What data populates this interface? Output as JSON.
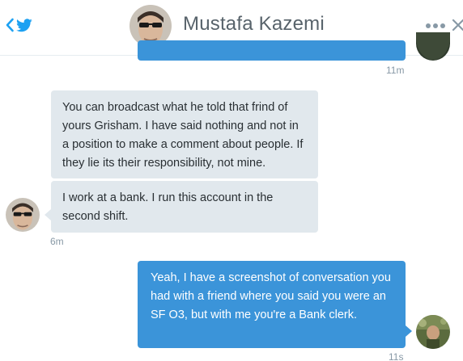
{
  "header": {
    "title": "Mustafa Kazemi"
  },
  "icons": {
    "back": "chevron-left-icon",
    "brand": "twitter-bird-icon",
    "more": "more-dots-icon",
    "close": "close-icon"
  },
  "colors": {
    "accent": "#1da1f2",
    "incoming_bubble": "#e1e8ed",
    "outgoing_bubble": "#3b94d9",
    "timestamp": "#8899a6",
    "title": "#58636b"
  },
  "messages": [
    {
      "direction": "outgoing",
      "text": "",
      "time": "11m"
    },
    {
      "direction": "incoming",
      "text": "You can broadcast what he told that frind of yours Grisham. I have said nothing and not in a position to make a comment about people. If they lie its their responsibility, not mine."
    },
    {
      "direction": "incoming",
      "text": "I work at a bank. I run this account in the second shift.",
      "time": "6m"
    },
    {
      "direction": "outgoing",
      "text": "Yeah, I have a screenshot of conversation you had with a friend where you said you were an SF O3, but with me you're a Bank clerk.",
      "time": "11s"
    }
  ]
}
